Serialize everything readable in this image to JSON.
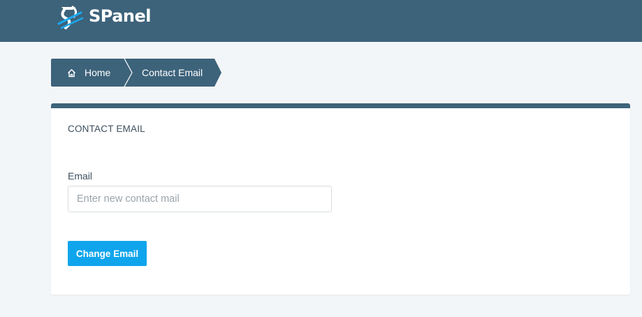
{
  "header": {
    "brand": "SPanel",
    "logo_icon": "spanel-logo-icon",
    "background": "#3d637b"
  },
  "breadcrumb": {
    "home_icon": "home-icon",
    "home_label": "Home",
    "current_label": "Contact Email"
  },
  "card": {
    "title": "CONTACT EMAIL",
    "email_label": "Email",
    "email_placeholder": "Enter new contact mail",
    "email_value": "",
    "submit_label": "Change Email",
    "accent": "#0fa5ec"
  }
}
